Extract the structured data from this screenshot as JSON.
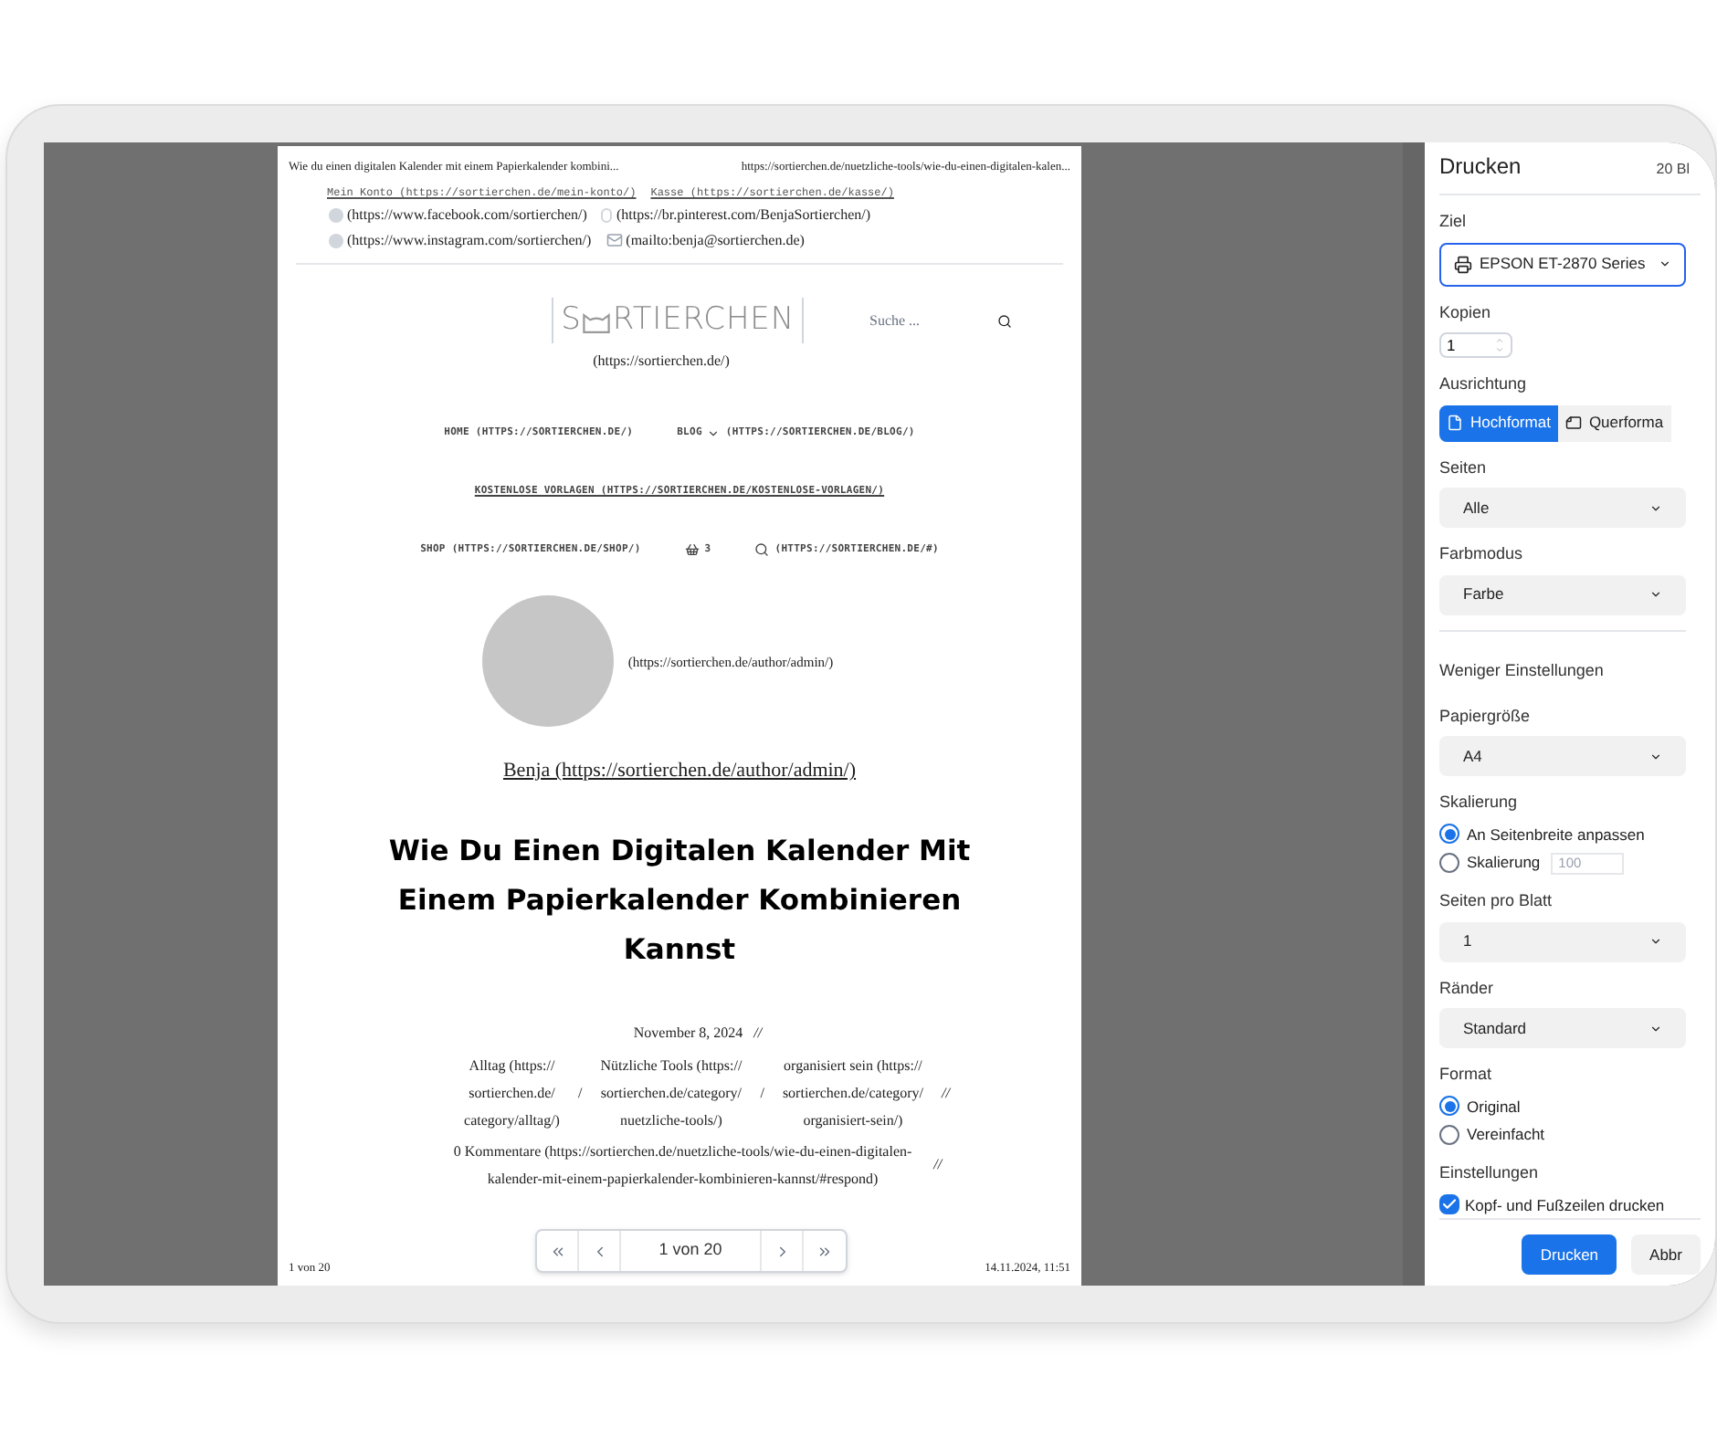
{
  "preview": {
    "header_left": "Wie du einen digitalen Kalender mit einem Papierkalender kombini...",
    "header_right": "https://sortierchen.de/nuetzliche-tools/wie-du-einen-digitalen-kalen...",
    "top_links": [
      "Mein Konto (https://sortierchen.de/mein-konto/)",
      "Kasse (https://sortierchen.de/kasse/)"
    ],
    "social_rows": [
      [
        {
          "kind": "facebook",
          "text": "(https://www.facebook.com/sortierchen/)"
        },
        {
          "kind": "pinterest",
          "text": "(https://br.pinterest.com/BenjaSortierchen/)"
        }
      ],
      [
        {
          "kind": "instagram",
          "text": "(https://www.instagram.com/sortierchen/)"
        },
        {
          "kind": "mail",
          "text": "(mailto:benja@sortierchen.de)"
        }
      ]
    ],
    "logo": {
      "before": "S",
      "after": "RTIERCHEN",
      "link": "(https://sortierchen.de/)"
    },
    "search": {
      "placeholder": "Suche ..."
    },
    "nav_rows": [
      [
        {
          "kind": "text",
          "text": "HOME (HTTPS://SORTIERCHEN.DE/)",
          "underlined": false
        },
        {
          "kind": "dropdown",
          "label": "BLOG",
          "text": "(HTTPS://SORTIERCHEN.DE/BLOG/)",
          "underlined": false
        }
      ],
      [
        {
          "kind": "text",
          "text": "KOSTENLOSE VORLAGEN (HTTPS://SORTIERCHEN.DE/KOSTENLOSE-VORLAGEN/)",
          "underlined": true
        }
      ],
      [
        {
          "kind": "text",
          "text": "SHOP (HTTPS://SORTIERCHEN.DE/SHOP/)",
          "underlined": false
        },
        {
          "kind": "cart",
          "text": "3",
          "underlined": false
        },
        {
          "kind": "search",
          "text": "(HTTPS://SORTIERCHEN.DE/#)",
          "underlined": false
        }
      ]
    ],
    "avatar_link": "(https://sortierchen.de/author/admin/)",
    "author": "Benja (https://sortierchen.de/author/admin/)",
    "title": "Wie Du Einen Digitalen Kalender Mit Einem Papierkalender Kombinieren Kannst",
    "date": "November 8, 2024",
    "date_sep": "//",
    "categories": [
      [
        "Alltag (https://",
        "sortierchen.de/",
        "category/alltag/)"
      ],
      [
        "Nützliche Tools (https://",
        "sortierchen.de/category/",
        "nuetzliche-tools/)"
      ],
      [
        "organisiert sein (https://",
        "sortierchen.de/category/",
        "organisiert-sein/)"
      ]
    ],
    "category_sep": "/",
    "categories_end": "//",
    "comments": [
      "0 Kommentare (https://sortierchen.de/nuetzliche-tools/wie-du-einen-digitalen-",
      "kalender-mit-einem-papierkalender-kombinieren-kannst/#respond)"
    ],
    "comments_end": "//",
    "footer_left": "1 von 20",
    "footer_right": "14.11.2024, 11:51"
  },
  "pager": {
    "label": "1 von 20"
  },
  "print_panel": {
    "title": "Drucken",
    "sheets": "20 Bl",
    "sections": [
      {
        "kind": "destination",
        "label": "Ziel",
        "value": "EPSON ET-2870 Series"
      },
      {
        "kind": "number",
        "label": "Kopien",
        "value": "1"
      },
      {
        "kind": "orientation",
        "label": "Ausrichtung",
        "options": [
          {
            "label": "Hochformat",
            "selected": true
          },
          {
            "label": "Querforma",
            "selected": false
          }
        ]
      },
      {
        "kind": "select",
        "label": "Seiten",
        "value": "Alle"
      },
      {
        "kind": "select",
        "label": "Farbmodus",
        "value": "Farbe"
      },
      {
        "kind": "link",
        "label": "Weniger Einstellungen"
      },
      {
        "kind": "select",
        "label": "Papiergröße",
        "value": "A4"
      },
      {
        "kind": "radio",
        "label": "Skalierung",
        "options": [
          {
            "label": "An Seitenbreite anpassen",
            "selected": true
          },
          {
            "label": "Skalierung",
            "selected": false,
            "input": "100"
          }
        ]
      },
      {
        "kind": "select",
        "label": "Seiten pro Blatt",
        "value": "1"
      },
      {
        "kind": "select",
        "label": "Ränder",
        "value": "Standard"
      },
      {
        "kind": "radio",
        "label": "Format",
        "options": [
          {
            "label": "Original",
            "selected": true
          },
          {
            "label": "Vereinfacht",
            "selected": false
          }
        ]
      },
      {
        "kind": "checkbox",
        "label": "Einstellungen",
        "options": [
          {
            "label": "Kopf- und Fußzeilen drucken",
            "checked": true
          }
        ]
      }
    ],
    "buttons": [
      {
        "label": "Drucken",
        "primary": true
      },
      {
        "label": "Abbr",
        "primary": false
      }
    ]
  }
}
